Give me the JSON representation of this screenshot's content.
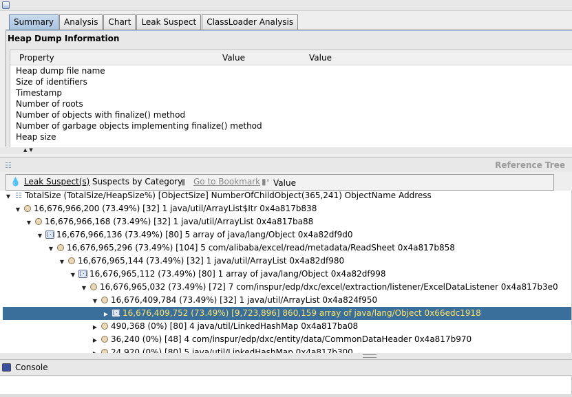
{
  "tabs": [
    {
      "label": "Summary",
      "active": true
    },
    {
      "label": "Analysis",
      "active": false
    },
    {
      "label": "Chart",
      "active": false
    },
    {
      "label": "Leak Suspect",
      "active": false
    },
    {
      "label": "ClassLoader Analysis",
      "active": false
    }
  ],
  "heap_info": {
    "title": "Heap Dump Information",
    "columns": [
      "Property",
      "Value",
      "Value"
    ],
    "rows": [
      "Heap dump file name",
      "Size of identifiers",
      "Timestamp",
      "Number of roots",
      "Number of objects with finalize() method",
      "Number of garbage objects implementing finalize() method",
      "Heap size"
    ]
  },
  "reference_tree": {
    "title": "Reference Tree",
    "toolbar": {
      "leak_suspects": "Leak Suspect(s)",
      "by_category": "Suspects by Category",
      "bookmark": "Go to Bookmark",
      "value": "Value"
    },
    "rows": [
      {
        "text": "TotalSize (TotalSize/HeapSize%) [ObjectSize] NumberOfChildObject(365,241) ObjectName Address",
        "icon": "root-icon"
      },
      {
        "text": "16,676,966,200 (73.49%) [32] 1 java/util/ArrayList$Itr 0x4a817b838",
        "icon": "object-icon"
      },
      {
        "text": "16,676,966,168 (73.49%) [32] 1 java/util/ArrayList 0x4a817ba88",
        "icon": "object-icon"
      },
      {
        "text": "16,676,966,136 (73.49%) [80] 5 array of java/lang/Object 0x4a82df9d0",
        "icon": "array-icon"
      },
      {
        "text": "16,676,965,296 (73.49%) [104] 5 com/alibaba/excel/read/metadata/ReadSheet 0x4a817b858",
        "icon": "object-icon"
      },
      {
        "text": "16,676,965,144 (73.49%) [32] 1 java/util/ArrayList 0x4a82df980",
        "icon": "object-icon"
      },
      {
        "text": "16,676,965,112 (73.49%) [80] 1 array of java/lang/Object 0x4a82df998",
        "icon": "array-icon"
      },
      {
        "text": "16,676,965,032 (73.49%) [72] 7 com/inspur/edp/dxc/excel/extraction/listener/ExcelDataListener 0x4a817b3e0",
        "icon": "object-icon"
      },
      {
        "text": "16,676,409,784 (73.49%) [32] 1 java/util/ArrayList 0x4a824f950",
        "icon": "object-icon"
      },
      {
        "text": "16,676,409,752 (73.49%) [9,723,896] 860,159 array of java/lang/Object 0x66edc1918",
        "icon": "array-icon"
      },
      {
        "text": "490,368 (0%) [80] 4 java/util/LinkedHashMap 0x4a817ba08",
        "icon": "object-icon"
      },
      {
        "text": "36,240 (0%) [48] 4 com/inspur/edp/dxc/entity/data/CommonDataHeader 0x4a817b970",
        "icon": "object-icon"
      },
      {
        "text": "24,920 (0%) [80] 5 java/util/LinkedHashMap 0x4a817b300",
        "icon": "object-icon"
      }
    ]
  },
  "console": {
    "label": "Console"
  },
  "colors": {
    "selection": "#3a6e9b",
    "selection_text": "#ffe36a",
    "tab_active": "#a9c3e0"
  }
}
